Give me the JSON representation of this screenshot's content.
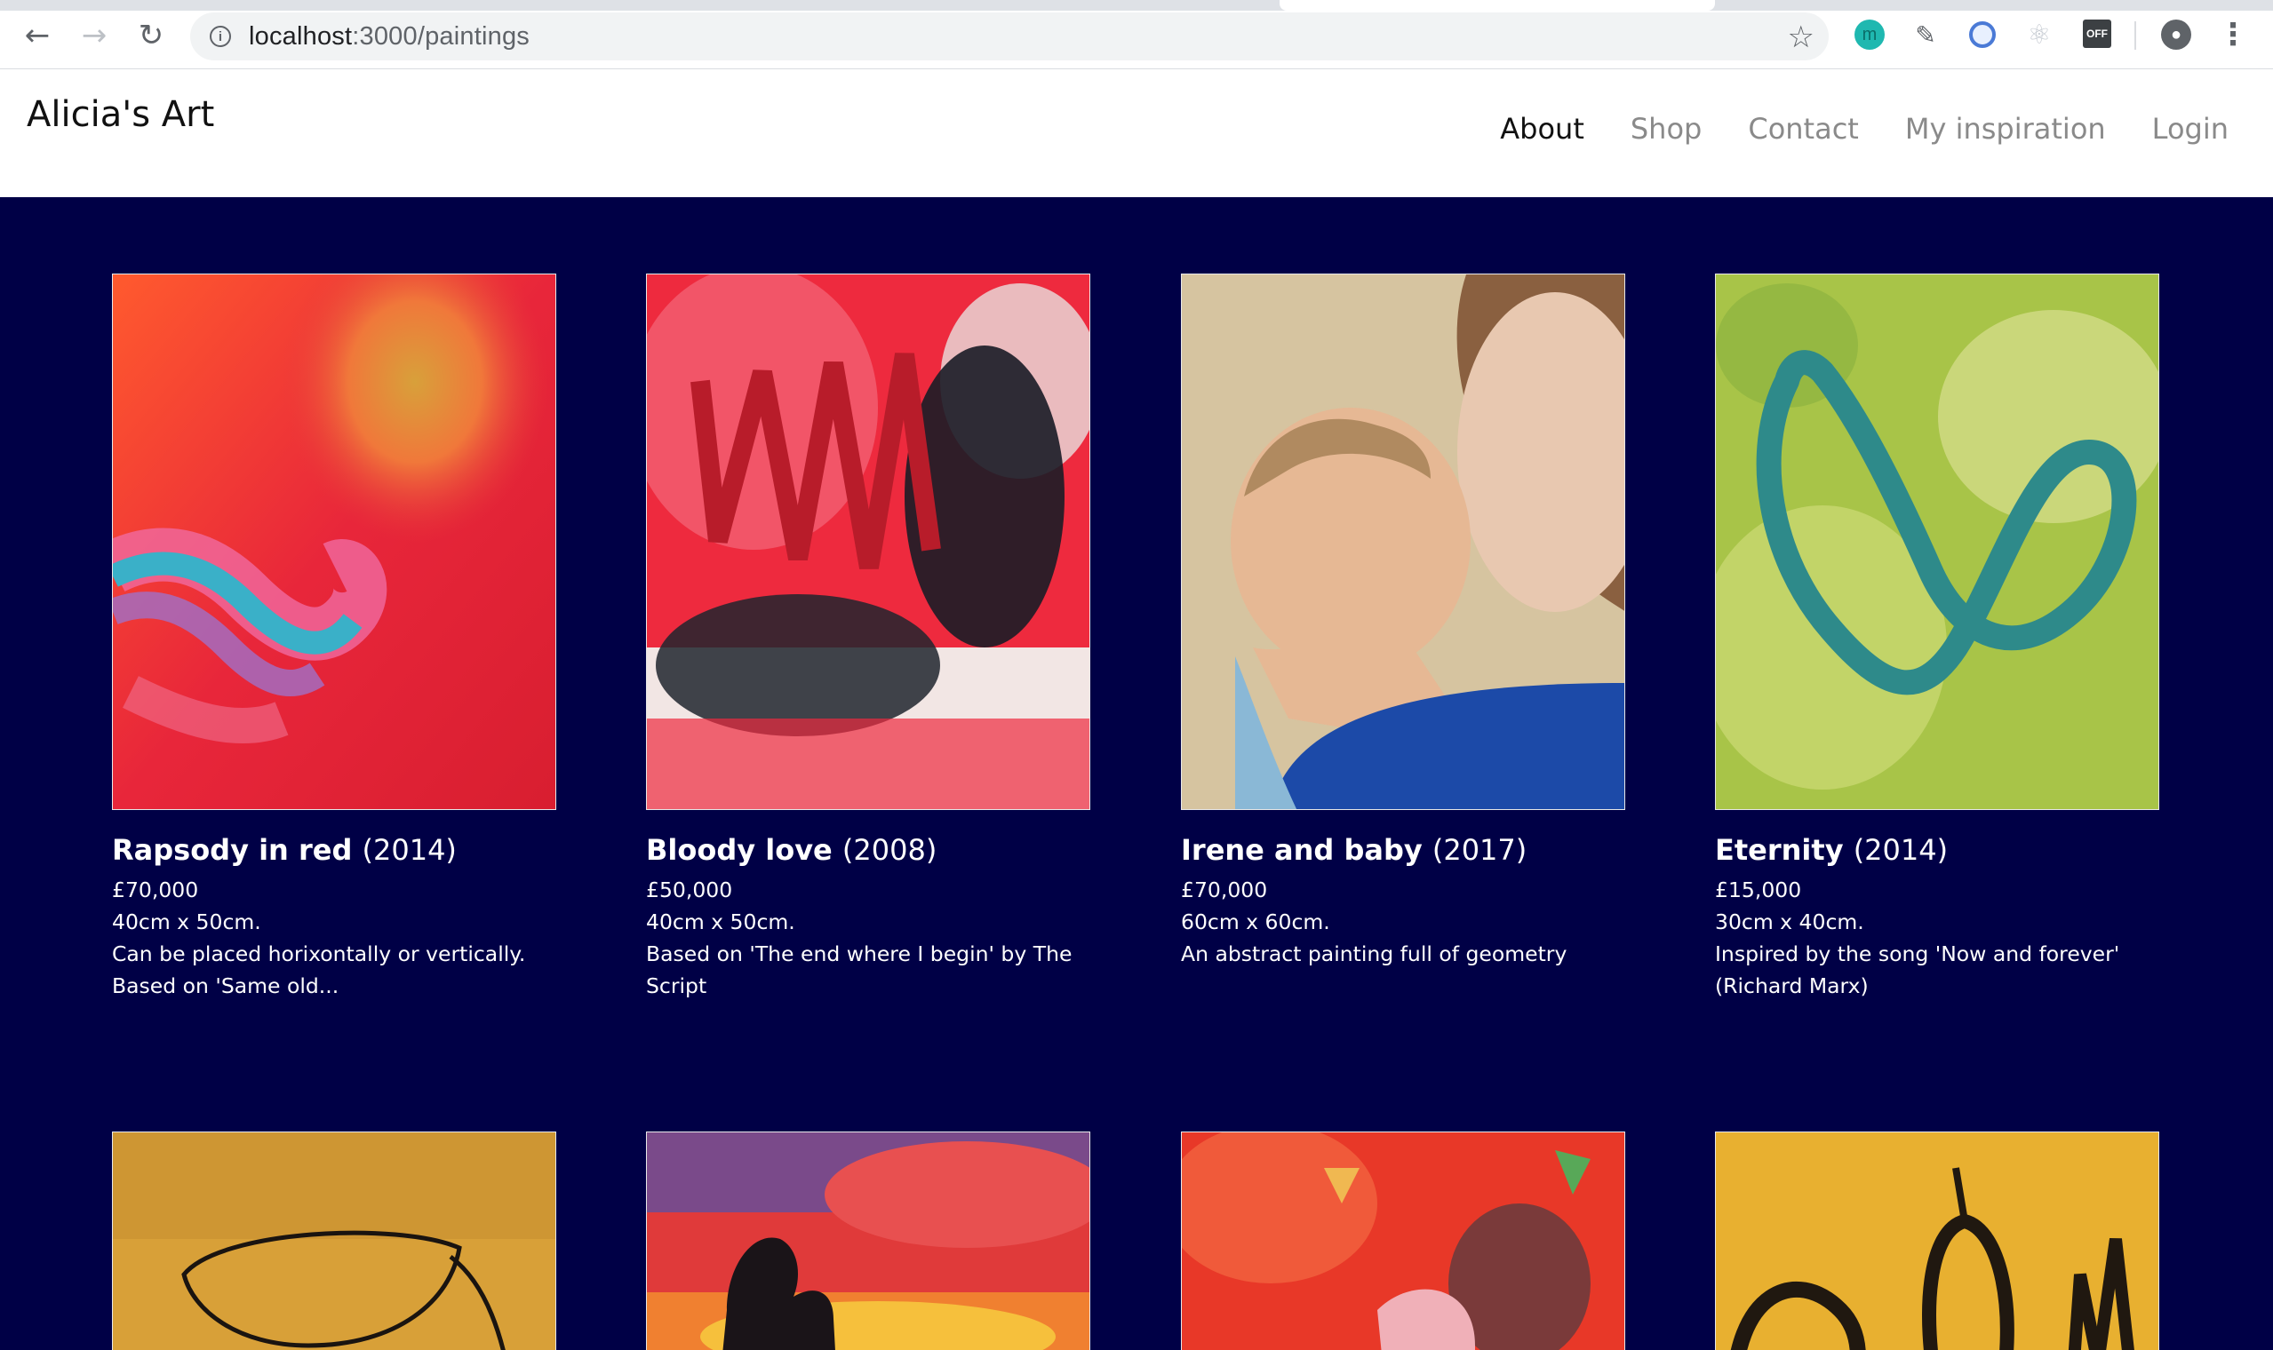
{
  "browser": {
    "url_host": "localhost",
    "url_path": ":3000/paintings",
    "extension_m_label": "m",
    "extension_off_label": "OFF"
  },
  "site": {
    "brand": "Alicia's Art",
    "nav": [
      {
        "label": "About",
        "active": true
      },
      {
        "label": "Shop",
        "active": false
      },
      {
        "label": "Contact",
        "active": false
      },
      {
        "label": "My inspiration",
        "active": false
      },
      {
        "label": "Login",
        "active": false
      }
    ]
  },
  "paintings": [
    {
      "title": "Rapsody in red",
      "year": "(2014)",
      "price": "£70,000",
      "size": "40cm x 50cm.",
      "description": "Can be placed horixontally or vertically. Based on 'Same old..."
    },
    {
      "title": "Bloody love",
      "year": "(2008)",
      "price": "£50,000",
      "size": "40cm x 50cm.",
      "description": "Based on 'The end where I begin' by The Script"
    },
    {
      "title": "Irene and baby",
      "year": "(2017)",
      "price": "£70,000",
      "size": "60cm x 60cm.",
      "description": "An abstract painting full of geometry"
    },
    {
      "title": "Eternity",
      "year": "(2014)",
      "price": "£15,000",
      "size": "30cm x 40cm.",
      "description": "Inspired by the song 'Now and forever' (Richard Marx)"
    }
  ],
  "colors": {
    "gallery_bg": "#000046",
    "header_bg": "#ffffff",
    "nav_active": "#111111",
    "nav_inactive": "#8a8a8a"
  }
}
